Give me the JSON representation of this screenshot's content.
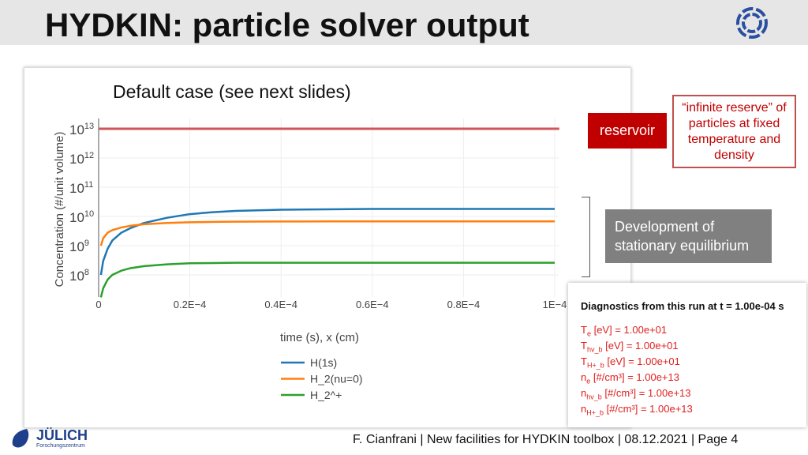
{
  "slide": {
    "title": "HYDKIN: particle solver output",
    "subtitle": "Default case (see next slides)",
    "footer": "F. Cianfrani | New facilities for HYDKIN toolbox | 08.12.2021 | Page 4",
    "logo_text": "JÜLICH",
    "logo_subtext": "Forschungszentrum"
  },
  "callouts": {
    "reservoir": "reservoir",
    "infinite_reserve": "“infinite reserve” of particles at fixed temperature and density",
    "development": "Development of stationary equilibrium"
  },
  "diagnostics": {
    "header": "Diagnostics from this run at t = 1.00e-04 s",
    "lines": [
      {
        "sym": "T",
        "sub": "e",
        "unit": " [eV] = 1.00e+01"
      },
      {
        "sym": "T",
        "sub": "hv_b",
        "unit": " [eV] = 1.00e+01"
      },
      {
        "sym": "T",
        "sub": "H+_b",
        "unit": " [eV] = 1.00e+01"
      },
      {
        "sym": "n",
        "sub": "e",
        "unit": " [#/cm³] = 1.00e+13"
      },
      {
        "sym": "n",
        "sub": "hv_b",
        "unit": " [#/cm³] = 1.00e+13"
      },
      {
        "sym": "n",
        "sub": "H+_b",
        "unit": " [#/cm³] = 1.00e+13"
      }
    ]
  },
  "chart_data": {
    "type": "line",
    "xlabel": "time (s), x (cm)",
    "ylabel": "Concentration (#/unit volume)",
    "yscale": "log",
    "xlim": [
      0,
      0.0001
    ],
    "ylim": [
      18000000.0,
      13000000000000.0
    ],
    "grid": true,
    "legend": "bottom",
    "xticks": [
      "0",
      "0.2E−4",
      "0.4E−4",
      "0.6E−4",
      "0.8E−4",
      "1E−4"
    ],
    "yticks": [
      {
        "base": "10",
        "exp": "13"
      },
      {
        "base": "10",
        "exp": "12"
      },
      {
        "base": "10",
        "exp": "11"
      },
      {
        "base": "10",
        "exp": "10"
      },
      {
        "base": "10",
        "exp": "9"
      },
      {
        "base": "10",
        "exp": "8"
      }
    ],
    "x": [
      5e-07,
      1e-06,
      2e-06,
      3e-06,
      5e-06,
      7e-06,
      1e-05,
      1.5e-05,
      2e-05,
      2.5e-05,
      3e-05,
      4e-05,
      5e-05,
      6e-05,
      8e-05,
      0.0001
    ],
    "reservoir": {
      "x": [
        0,
        0.000101
      ],
      "y": [
        10000000000000.0,
        10000000000000.0
      ],
      "color": "#d0555a"
    },
    "series": [
      {
        "name": "H(1s)",
        "color": "#1f77b4",
        "y": [
          100000000.0,
          300000000.0,
          800000000.0,
          1500000000.0,
          2800000000.0,
          4000000000.0,
          6000000000.0,
          9000000000.0,
          12000000000.0,
          14000000000.0,
          15500000000.0,
          17000000000.0,
          17500000000.0,
          18000000000.0,
          18000000000.0,
          18000000000.0
        ]
      },
      {
        "name": "H_2(nu=0)",
        "color": "#ff7f0e",
        "y": [
          1000000000.0,
          1800000000.0,
          2800000000.0,
          3400000000.0,
          4200000000.0,
          4800000000.0,
          5400000000.0,
          6000000000.0,
          6300000000.0,
          6500000000.0,
          6600000000.0,
          6700000000.0,
          6800000000.0,
          6800000000.0,
          6800000000.0,
          6800000000.0
        ]
      },
      {
        "name": "H_2^+",
        "color": "#2ca02c",
        "y": [
          17000000.0,
          35000000.0,
          70000000.0,
          100000000.0,
          140000000.0,
          170000000.0,
          200000000.0,
          230000000.0,
          250000000.0,
          255000000.0,
          260000000.0,
          260000000.0,
          260000000.0,
          260000000.0,
          260000000.0,
          260000000.0
        ]
      }
    ]
  }
}
